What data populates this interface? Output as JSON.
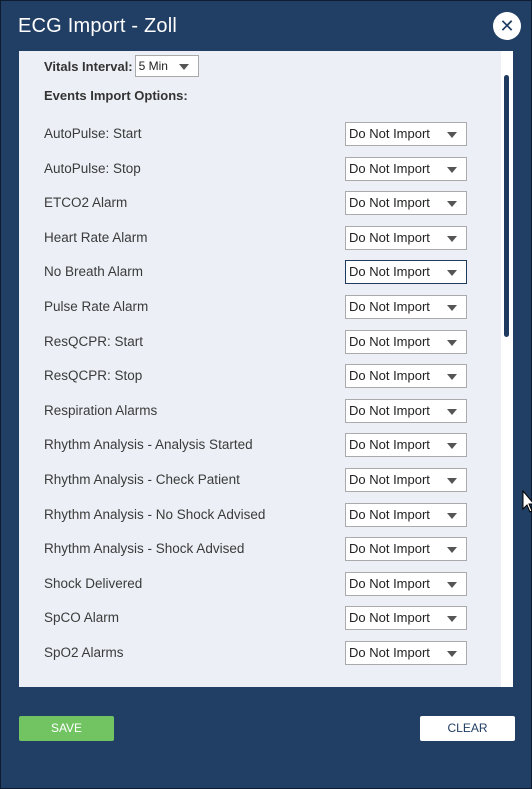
{
  "dialog": {
    "title": "ECG Import - Zoll",
    "close_symbol": "✕"
  },
  "vitals": {
    "label": "Vitals Interval:",
    "value": "5 Min"
  },
  "events": {
    "label": "Events Import Options:",
    "items": [
      {
        "label": "AutoPulse: Start",
        "value": "Do Not Import"
      },
      {
        "label": "AutoPulse: Stop",
        "value": "Do Not Import"
      },
      {
        "label": "ETCO2 Alarm",
        "value": "Do Not Import"
      },
      {
        "label": "Heart Rate Alarm",
        "value": "Do Not Import"
      },
      {
        "label": "No Breath Alarm",
        "value": "Do Not Import"
      },
      {
        "label": "Pulse Rate Alarm",
        "value": "Do Not Import"
      },
      {
        "label": "ResQCPR: Start",
        "value": "Do Not Import"
      },
      {
        "label": "ResQCPR: Stop",
        "value": "Do Not Import"
      },
      {
        "label": "Respiration Alarms",
        "value": "Do Not Import"
      },
      {
        "label": "Rhythm Analysis - Analysis Started",
        "value": "Do Not Import"
      },
      {
        "label": "Rhythm Analysis - Check Patient",
        "value": "Do Not Import"
      },
      {
        "label": "Rhythm Analysis - No Shock Advised",
        "value": "Do Not Import"
      },
      {
        "label": "Rhythm Analysis - Shock Advised",
        "value": "Do Not Import"
      },
      {
        "label": "Shock Delivered",
        "value": "Do Not Import"
      },
      {
        "label": "SpCO Alarm",
        "value": "Do Not Import"
      },
      {
        "label": "SpO2 Alarms",
        "value": "Do Not Import"
      }
    ]
  },
  "footer": {
    "save_label": "SAVE",
    "clear_label": "CLEAR"
  },
  "colors": {
    "dialog_bg": "#213f64",
    "panel_bg": "#ecf0f6",
    "save_green": "#72c462",
    "accent_navy": "#1f3a5f"
  }
}
